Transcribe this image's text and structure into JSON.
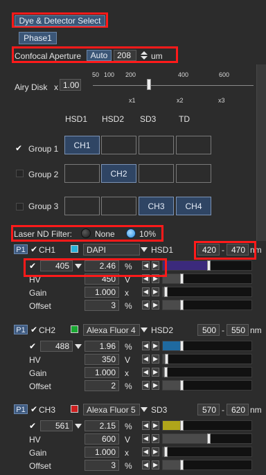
{
  "header": {
    "title_button": "Dye & Detector Select",
    "phase_button": "Phase1"
  },
  "aperture": {
    "label": "Confocal Aperture",
    "auto_label": "Auto",
    "value": "208",
    "unit": "um"
  },
  "airy": {
    "label": "Airy Disk",
    "mult_prefix": "x",
    "value": "1.00",
    "top_ticks": [
      "50",
      "100",
      "200",
      "400",
      "600"
    ],
    "bottom_ticks": [
      "x1",
      "x2",
      "x3"
    ],
    "slider_level_fraction": 0.35
  },
  "groups": {
    "detectors": [
      "HSD1",
      "HSD2",
      "SD3",
      "TD"
    ],
    "rows": [
      {
        "label": "Group 1",
        "checked": true,
        "cells": [
          "CH1",
          "",
          "",
          ""
        ]
      },
      {
        "label": "Group 2",
        "checked": false,
        "cells": [
          "",
          "CH2",
          "",
          ""
        ]
      },
      {
        "label": "Group 3",
        "checked": false,
        "cells": [
          "",
          "",
          "CH3",
          "CH4"
        ]
      }
    ]
  },
  "laser_nd": {
    "label": "Laser ND Filter:",
    "options": [
      "None",
      "10%"
    ],
    "selected": "10%"
  },
  "channels": [
    {
      "badge": "P1",
      "name": "CH1",
      "dye": "DAPI",
      "detector": "HSD1",
      "range_start": "420",
      "range_end": "470",
      "range_unit": "nm",
      "color": "#29b2d8",
      "laser": {
        "wavelength": "405",
        "power": "2.46",
        "unit": "%",
        "bar_color": "#3b2a7c",
        "level_fraction": 0.5
      },
      "hv": {
        "label": "HV",
        "value": "450",
        "unit": "V",
        "level_fraction": 0.2
      },
      "gain": {
        "label": "Gain",
        "value": "1.000",
        "unit": "x",
        "level_fraction": 0.02
      },
      "offset": {
        "label": "Offset",
        "value": "3",
        "unit": "%",
        "level_fraction": 0.2
      }
    },
    {
      "badge": "P1",
      "name": "CH2",
      "dye": "Alexa Fluor 4",
      "detector": "HSD2",
      "range_start": "500",
      "range_end": "550",
      "range_unit": "nm",
      "color": "#19a832",
      "laser": {
        "wavelength": "488",
        "power": "1.96",
        "unit": "%",
        "bar_color": "#1f6aa0",
        "level_fraction": 0.2
      },
      "hv": {
        "label": "HV",
        "value": "350",
        "unit": "V",
        "level_fraction": 0.03
      },
      "gain": {
        "label": "Gain",
        "value": "1.000",
        "unit": "x",
        "level_fraction": 0.02
      },
      "offset": {
        "label": "Offset",
        "value": "2",
        "unit": "%",
        "level_fraction": 0.2
      }
    },
    {
      "badge": "P1",
      "name": "CH3",
      "dye": "Alexa Fluor 5",
      "detector": "SD3",
      "range_start": "570",
      "range_end": "620",
      "range_unit": "nm",
      "color": "#cc1f1f",
      "laser": {
        "wavelength": "561",
        "power": "2.15",
        "unit": "%",
        "bar_color": "#b0a51a",
        "level_fraction": 0.2
      },
      "hv": {
        "label": "HV",
        "value": "600",
        "unit": "V",
        "level_fraction": 0.5
      },
      "gain": {
        "label": "Gain",
        "value": "1.000",
        "unit": "x",
        "level_fraction": 0.02
      },
      "offset": {
        "label": "Offset",
        "value": "3",
        "unit": "%",
        "level_fraction": 0.2
      }
    }
  ]
}
